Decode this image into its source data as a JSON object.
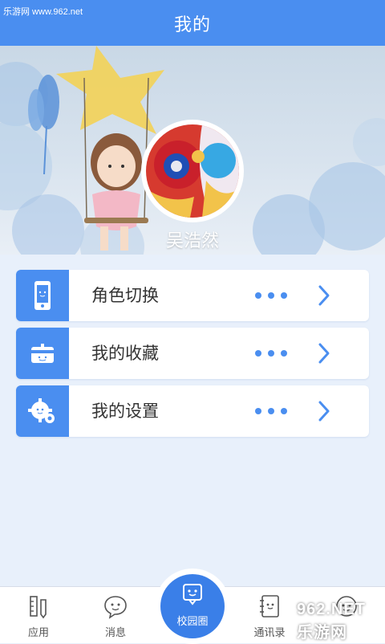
{
  "watermark_top": "乐游网 www.962.net",
  "header": {
    "title": "我的"
  },
  "profile": {
    "name": "吴浩然"
  },
  "menu": [
    {
      "label": "角色切换",
      "icon": "phone-icon"
    },
    {
      "label": "我的收藏",
      "icon": "gift-card-icon"
    },
    {
      "label": "我的设置",
      "icon": "gear-icon"
    }
  ],
  "tabs": [
    {
      "label": "应用",
      "icon": "ruler-pencil-icon"
    },
    {
      "label": "消息",
      "icon": "chat-bubble-icon"
    },
    {
      "label": "校园圈",
      "icon": "smile-chat-icon"
    },
    {
      "label": "通讯录",
      "icon": "notebook-icon"
    },
    {
      "label": "",
      "icon": "mascot-icon"
    }
  ],
  "watermark_bottom": "962.NET 乐游网",
  "colors": {
    "primary": "#4a8ef0",
    "background": "#e8f0fb"
  }
}
